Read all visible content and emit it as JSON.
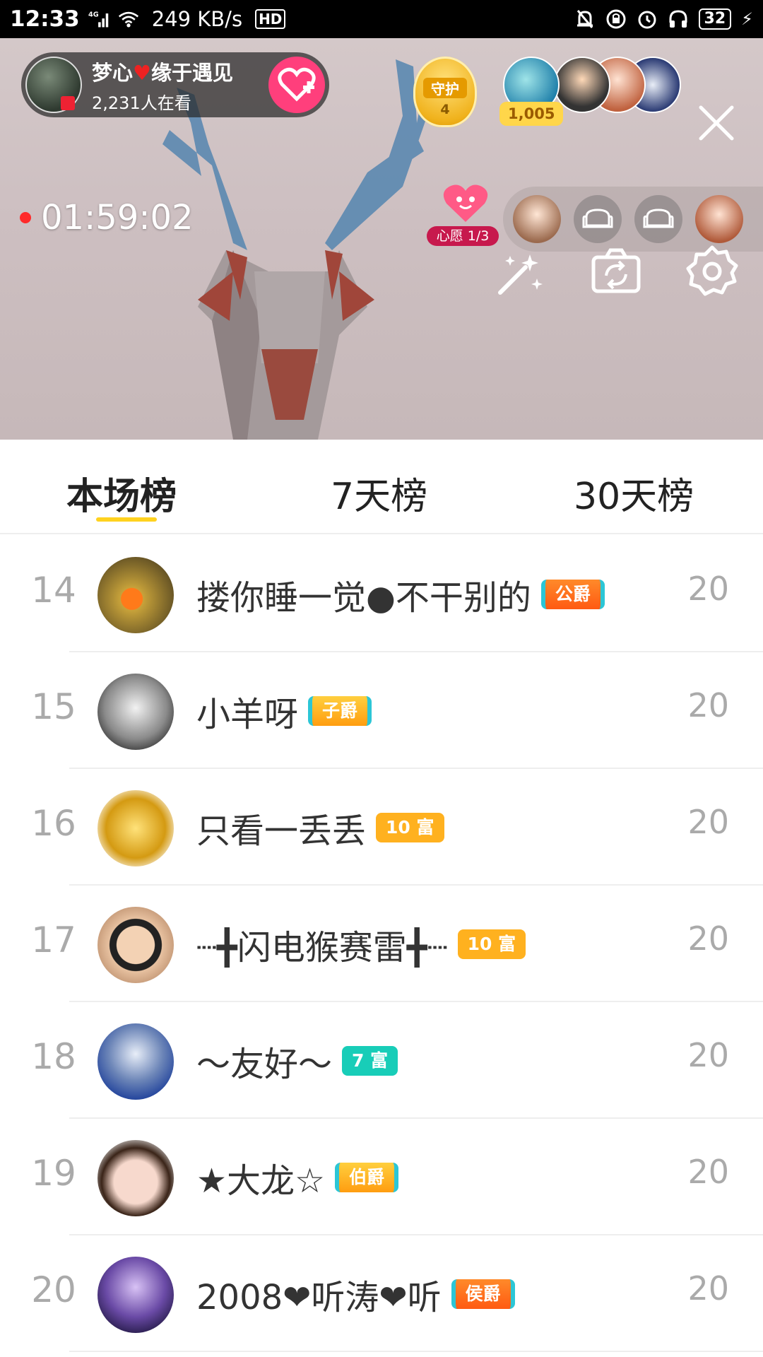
{
  "status_bar": {
    "time": "12:33",
    "network": "4G",
    "speed": "249 KB/s",
    "hd": "HD",
    "battery": "32"
  },
  "stream": {
    "host_name_part1": "梦心",
    "host_name_part2": "缘于遇见",
    "viewers": "2,231人在看",
    "guard_label": "守护",
    "guard_count": "4",
    "fans_count": "1,005",
    "timer": "01:59:02",
    "wish_label": "心愿 1/3"
  },
  "tabs": [
    {
      "label": "本场榜",
      "active": true
    },
    {
      "label": "7天榜",
      "active": false
    },
    {
      "label": "30天榜",
      "active": false
    }
  ],
  "ranking": [
    {
      "rank": "14",
      "name": "搂你睡一觉●不干别的",
      "badge": "公爵",
      "badge_style": "orange",
      "score": "20"
    },
    {
      "rank": "15",
      "name": "小羊呀",
      "badge": "子爵",
      "badge_style": "amber",
      "score": "20"
    },
    {
      "rank": "16",
      "name": "只看一丢丢",
      "badge": "10 富",
      "badge_style": "gold",
      "score": "20"
    },
    {
      "rank": "17",
      "name": "┈╋闪电猴赛雷╋┈",
      "badge": "10 富",
      "badge_style": "gold",
      "score": "20"
    },
    {
      "rank": "18",
      "name": "～友好～",
      "badge": "7 富",
      "badge_style": "teal",
      "score": "20"
    },
    {
      "rank": "19",
      "name": "★大龙☆",
      "badge": "伯爵",
      "badge_style": "amber",
      "score": "20"
    },
    {
      "rank": "20",
      "name": "2008❤听涛❤听",
      "badge": "侯爵",
      "badge_style": "orange",
      "score": "20"
    }
  ]
}
